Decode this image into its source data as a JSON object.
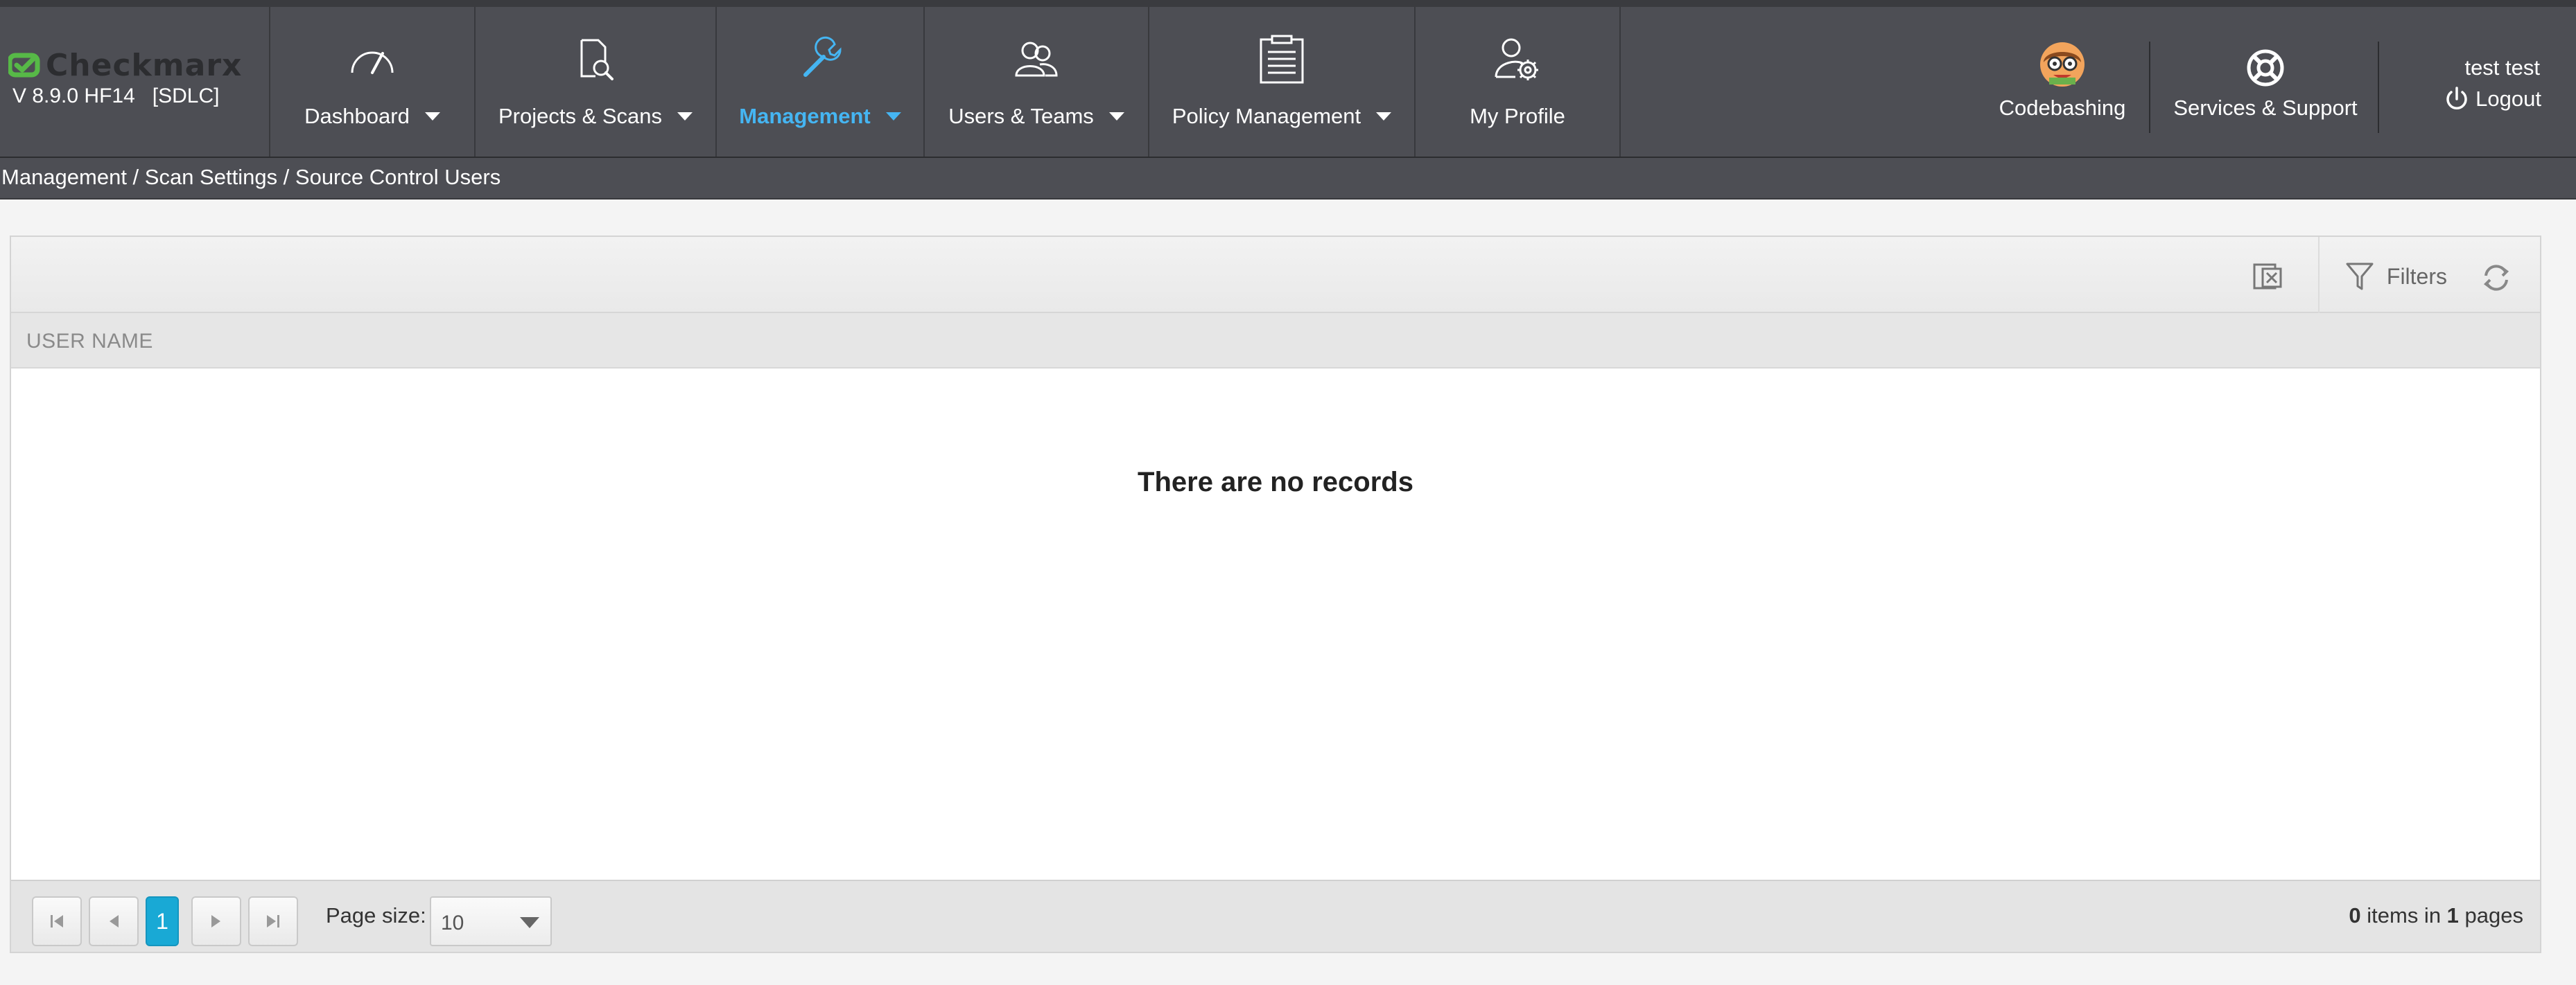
{
  "brand": {
    "logo_text": "Checkmarx",
    "version": "V 8.9.0 HF14   [SDLC]"
  },
  "nav": {
    "dashboard": "Dashboard",
    "projects": "Projects & Scans",
    "management": "Management",
    "users": "Users & Teams",
    "policy": "Policy Management",
    "profile": "My Profile"
  },
  "right_nav": {
    "codebashing": "Codebashing",
    "support": "Services & Support",
    "user_name": "test test",
    "logout": "Logout"
  },
  "breadcrumb": "Management / Scan Settings / Source Control Users",
  "toolbar": {
    "filters": "Filters"
  },
  "grid": {
    "column_header": "USER NAME",
    "empty_message": "There are no records"
  },
  "pager": {
    "current_page": "1",
    "page_size_label": "Page size:",
    "page_size_value": "10",
    "items_count": "0",
    "items_text": " items in ",
    "pages_count": "1",
    "pages_text": " pages"
  },
  "colors": {
    "nav_bg": "#4d4e54",
    "active_nav": "#45b5f2",
    "current_page": "#19a9d5",
    "brand_green": "#57b947"
  },
  "icons": [
    "dashboard-gauge-icon",
    "projects-search-icon",
    "management-wrench-icon",
    "users-icon",
    "policy-clipboard-icon",
    "profile-gear-icon",
    "codebashing-avatar-icon",
    "support-lifebuoy-icon",
    "power-icon",
    "export-icon",
    "filter-icon",
    "refresh-icon",
    "first-page-icon",
    "prev-page-icon",
    "next-page-icon",
    "last-page-icon"
  ]
}
